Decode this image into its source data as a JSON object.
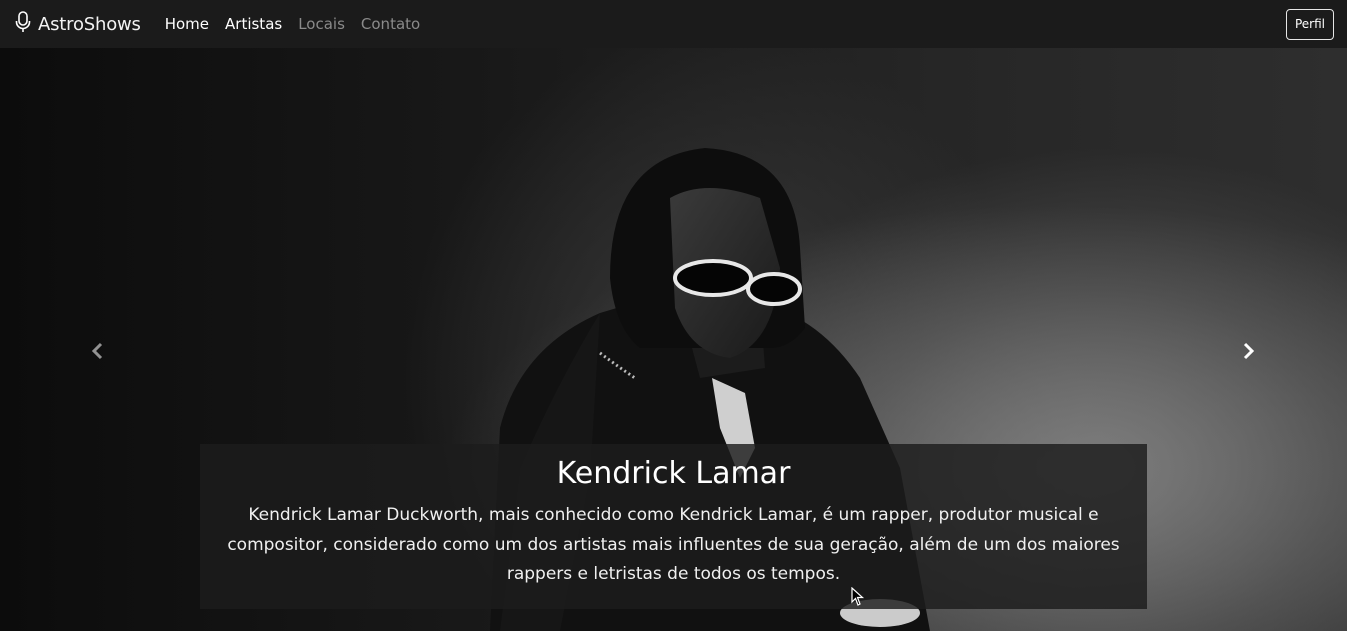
{
  "navbar": {
    "brand": {
      "icon": "microphone-icon",
      "name": "AstroShows"
    },
    "links": [
      {
        "label": "Home",
        "active": true
      },
      {
        "label": "Artistas",
        "active": true
      },
      {
        "label": "Locais",
        "active": false
      },
      {
        "label": "Contato",
        "active": false
      }
    ],
    "profile_button": "Perfil"
  },
  "carousel": {
    "prev_icon": "chevron-left-icon",
    "next_icon": "chevron-right-icon",
    "slide": {
      "image": "black-and-white-photo-of-artist-with-sunglasses",
      "title": "Kendrick Lamar",
      "description": "Kendrick Lamar Duckworth, mais conhecido como Kendrick Lamar, é um rapper, produtor musical e compositor, considerado como um dos artistas mais influentes de sua geração, além de um dos maiores rappers e letristas de todos os tempos."
    }
  },
  "colors": {
    "navbar_bg": "#1b1b1b",
    "nav_active": "#ffffff",
    "nav_inactive": "#8a8a8a",
    "caption_bg": "#1c1c1c"
  }
}
